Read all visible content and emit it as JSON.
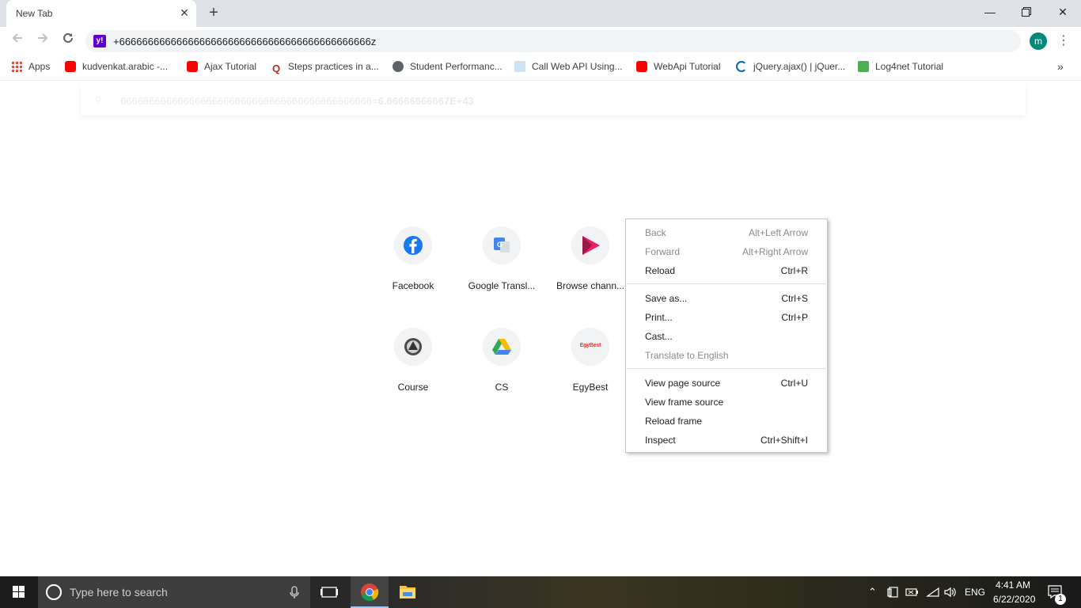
{
  "tab": {
    "title": "New Tab"
  },
  "omnibox": {
    "text": "+66666666666666666666666666666666666666666666z"
  },
  "avatar": {
    "initial": "m"
  },
  "bookmarks": [
    {
      "label": "Apps",
      "icon": "apps-grid-icon"
    },
    {
      "label": "kudvenkat.arabic -...",
      "icon": "youtube-icon"
    },
    {
      "label": "Ajax Tutorial",
      "icon": "youtube-icon"
    },
    {
      "label": "Steps practices in a...",
      "icon": "quora-icon"
    },
    {
      "label": "Student Performanc...",
      "icon": "globe-icon"
    },
    {
      "label": "Call Web API Using...",
      "icon": "web-api-icon"
    },
    {
      "label": "WebApi Tutorial",
      "icon": "youtube-icon"
    },
    {
      "label": "jQuery.ajax() | jQuer...",
      "icon": "jquery-icon"
    },
    {
      "label": "Log4net Tutorial",
      "icon": "log4net-icon"
    }
  ],
  "suggestion": {
    "query": "66666666666666666666666666666666666666666666=",
    "result": "6.66666666667E+43"
  },
  "tiles": [
    {
      "label": "Facebook",
      "icon": "facebook-icon"
    },
    {
      "label": "Google Transl...",
      "icon": "google-translate-icon"
    },
    {
      "label": "Browse chann...",
      "icon": "play-icon"
    },
    {
      "label": "Course",
      "icon": "course-icon"
    },
    {
      "label": "CS",
      "icon": "google-drive-icon"
    },
    {
      "label": "EgyBest",
      "icon": "egybest-icon"
    }
  ],
  "egybest_logo_text": "EgyBest",
  "context_menu": [
    {
      "label": "Back",
      "shortcut": "Alt+Left Arrow",
      "disabled": true
    },
    {
      "label": "Forward",
      "shortcut": "Alt+Right Arrow",
      "disabled": true
    },
    {
      "label": "Reload",
      "shortcut": "Ctrl+R",
      "disabled": false
    },
    {
      "label": "Save as...",
      "shortcut": "Ctrl+S",
      "disabled": false
    },
    {
      "label": "Print...",
      "shortcut": "Ctrl+P",
      "disabled": false
    },
    {
      "label": "Cast...",
      "shortcut": "",
      "disabled": false
    },
    {
      "label": "Translate to English",
      "shortcut": "",
      "disabled": true
    },
    {
      "label": "View page source",
      "shortcut": "Ctrl+U",
      "disabled": false
    },
    {
      "label": "View frame source",
      "shortcut": "",
      "disabled": false
    },
    {
      "label": "Reload frame",
      "shortcut": "",
      "disabled": false
    },
    {
      "label": "Inspect",
      "shortcut": "Ctrl+Shift+I",
      "disabled": false
    }
  ],
  "taskbar": {
    "search_placeholder": "Type here to search",
    "language": "ENG",
    "time": "4:41 AM",
    "date": "6/22/2020",
    "notification_count": "1"
  }
}
